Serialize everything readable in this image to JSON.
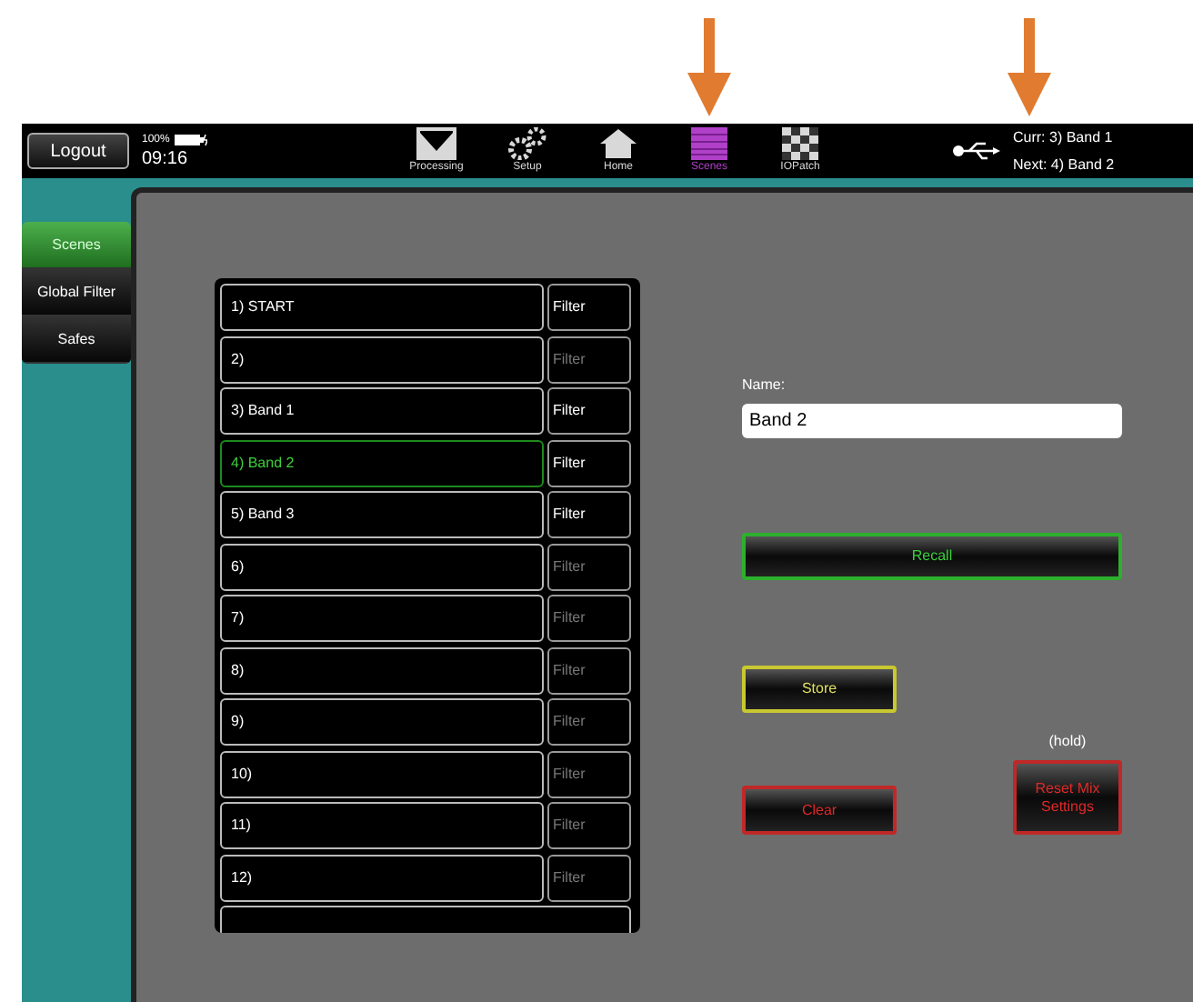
{
  "top_bar": {
    "logout": "Logout",
    "battery": "100%",
    "time": "09:16",
    "nav": [
      {
        "label": "Processing",
        "kind": "processing",
        "selected": false
      },
      {
        "label": "Setup",
        "kind": "setup",
        "selected": false
      },
      {
        "label": "Home",
        "kind": "home",
        "selected": false
      },
      {
        "label": "Scenes",
        "kind": "scenes",
        "selected": true
      },
      {
        "label": "IOPatch",
        "kind": "iopatch",
        "selected": false
      }
    ],
    "current": "Curr: 3) Band 1",
    "next": "Next: 4) Band 2"
  },
  "sidebar": {
    "items": [
      {
        "label": "Scenes",
        "selected": true
      },
      {
        "label": "Global Filter",
        "selected": false
      },
      {
        "label": "Safes",
        "selected": false
      }
    ]
  },
  "scenes": [
    {
      "name": "1) START",
      "filter": "Filter",
      "filter_active": true,
      "selected": false
    },
    {
      "name": "2)",
      "filter": "Filter",
      "filter_active": false,
      "selected": false
    },
    {
      "name": "3) Band 1",
      "filter": "Filter",
      "filter_active": true,
      "selected": false
    },
    {
      "name": "4) Band 2",
      "filter": "Filter",
      "filter_active": true,
      "selected": true
    },
    {
      "name": "5) Band 3",
      "filter": "Filter",
      "filter_active": true,
      "selected": false
    },
    {
      "name": "6)",
      "filter": "Filter",
      "filter_active": false,
      "selected": false
    },
    {
      "name": "7)",
      "filter": "Filter",
      "filter_active": false,
      "selected": false
    },
    {
      "name": "8)",
      "filter": "Filter",
      "filter_active": false,
      "selected": false
    },
    {
      "name": "9)",
      "filter": "Filter",
      "filter_active": false,
      "selected": false
    },
    {
      "name": "10)",
      "filter": "Filter",
      "filter_active": false,
      "selected": false
    },
    {
      "name": "11)",
      "filter": "Filter",
      "filter_active": false,
      "selected": false
    },
    {
      "name": "12)",
      "filter": "Filter",
      "filter_active": false,
      "selected": false
    }
  ],
  "name_field": {
    "label": "Name:",
    "value": "Band 2"
  },
  "buttons": {
    "recall": "Recall",
    "store": "Store",
    "clear": "Clear",
    "hold_note": "(hold)",
    "reset": "Reset Mix Settings"
  }
}
